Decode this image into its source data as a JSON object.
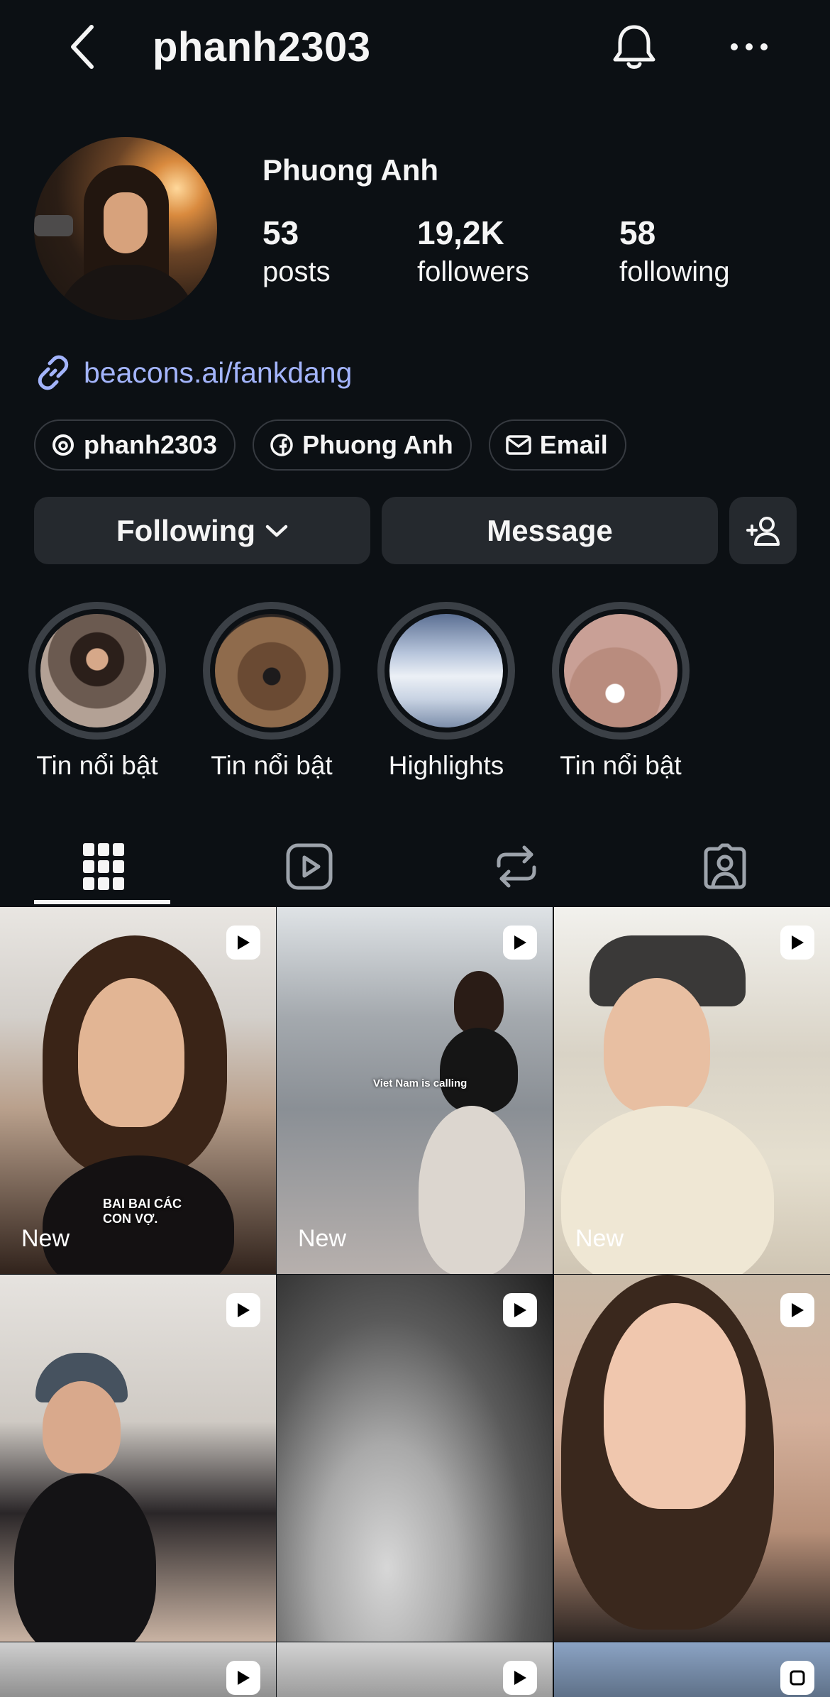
{
  "header": {
    "username": "phanh2303"
  },
  "profile": {
    "display_name": "Phuong Anh",
    "stats": {
      "posts": {
        "value": "53",
        "label": "posts"
      },
      "followers": {
        "value": "19,2K",
        "label": "followers"
      },
      "following": {
        "value": "58",
        "label": "following"
      }
    },
    "link": "beacons.ai/fankdang",
    "chips": {
      "threads": "phanh2303",
      "facebook": "Phuong Anh",
      "email": "Email"
    }
  },
  "actions": {
    "following_label": "Following",
    "message_label": "Message"
  },
  "highlights": [
    {
      "label": "Tin nổi bật"
    },
    {
      "label": "Tin nổi bật"
    },
    {
      "label": "Highlights"
    },
    {
      "label": "Tin nổi bật"
    }
  ],
  "tabs": [
    "grid-icon",
    "reels-icon",
    "reposts-icon",
    "tagged-icon"
  ],
  "grid": {
    "posts": [
      {
        "new_label": "New",
        "overlay": "BAI BAI CÁC\nCON VỢ."
      },
      {
        "new_label": "New",
        "overlay": "Viet Nam is calling"
      },
      {
        "new_label": "New",
        "overlay": ""
      },
      {
        "new_label": "",
        "overlay": ""
      },
      {
        "new_label": "",
        "overlay": ""
      },
      {
        "new_label": "",
        "overlay": ""
      }
    ]
  },
  "colors": {
    "background": "#0c1014",
    "button": "#25292e",
    "link": "#a3b4fb"
  }
}
